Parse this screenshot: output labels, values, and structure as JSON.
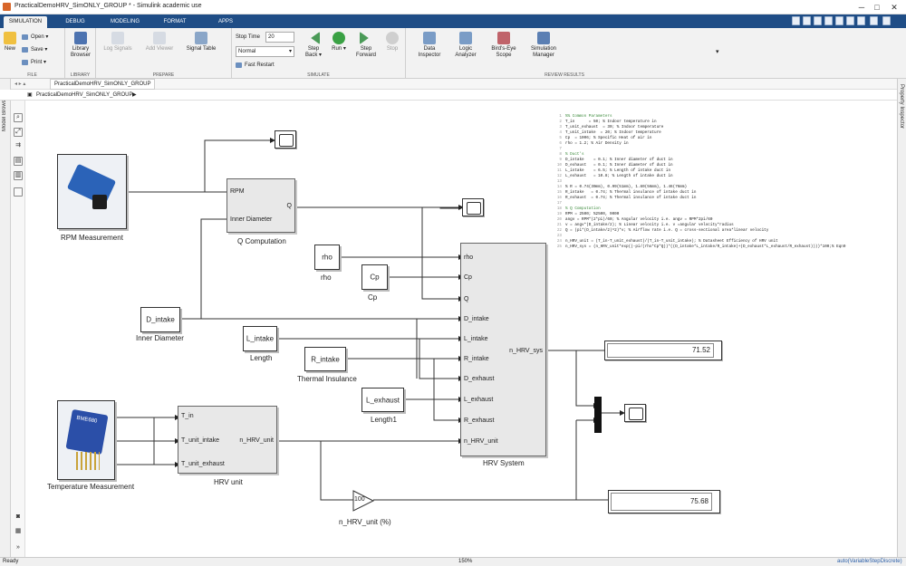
{
  "window": {
    "title": "PracticalDemoHRV_SimONLY_GROUP * - Simulink academic use"
  },
  "tabs": [
    "SIMULATION",
    "DEBUG",
    "MODELING",
    "FORMAT",
    "APPS"
  ],
  "ribbon": {
    "file": {
      "open": "Open",
      "save": "Save",
      "print": "Print",
      "new": "New",
      "label": "FILE"
    },
    "library": {
      "browser": "Library Browser",
      "label": "LIBRARY"
    },
    "prepare": {
      "log": "Log Signals",
      "add_viewer": "Add Viewer",
      "signal_table": "Signal Table",
      "label": "PREPARE"
    },
    "simulate": {
      "stop_time_label": "Stop Time",
      "stop_time_value": "20",
      "mode": "Normal",
      "fast_restart": "Fast Restart",
      "step_back": "Step Back",
      "run": "Run",
      "step_forward": "Step Forward",
      "stop": "Stop",
      "label": "SIMULATE"
    },
    "review": {
      "data_inspector": "Data Inspector",
      "logic_analyzer": "Logic Analyzer",
      "birds_eye": "Bird's-Eye Scope",
      "sim_manager": "Simulation Manager",
      "label": "REVIEW RESULTS"
    }
  },
  "address": {
    "model": "PracticalDemoHRV_SimONLY_GROUP"
  },
  "breadcrumb": {
    "path": "PracticalDemoHRV_SimONLY_GROUP"
  },
  "side": {
    "model_browser": "Model Browser",
    "property_inspector": "Property Inspector"
  },
  "blocks": {
    "rpm": "RPM Measurement",
    "qcomp": "Q Computation",
    "qcomp_in1": "RPM",
    "qcomp_in2": "Inner Diameter",
    "qcomp_out": "Q",
    "rho_val": "rho",
    "rho_lbl": "rho",
    "cp_val": "Cp",
    "cp_lbl": "Cp",
    "d_val": "D_intake",
    "d_lbl": "Inner Diameter",
    "l_val": "L_intake",
    "l_lbl": "Length",
    "r_val": "R_intake",
    "r_lbl": "Thermal Insulance",
    "le_val": "L_exhaust",
    "le_lbl": "Length1",
    "hrv_sys": "HRV System",
    "hrv_ports": [
      "rho",
      "Cp",
      "Q",
      "D_intake",
      "L_intake",
      "R_intake",
      "D_exhaust",
      "L_exhaust",
      "R_exhaust",
      "n_HRV_unit"
    ],
    "hrv_sys_out": "n_HRV_sys",
    "temp": "Temperature Measurement",
    "hrv_unit": "HRV unit",
    "hrv_unit_ports": [
      "T_in",
      "T_unit_intake",
      "T_unit_exhaust"
    ],
    "hrv_unit_out": "n_HRV_unit",
    "gain_val": "100",
    "gain_lbl": "n_HRV_unit (%)",
    "display1": "71.52",
    "display2": "75.68",
    "sensor_chip": "BME680"
  },
  "code": [
    {
      "n": "1",
      "t": "%% Common Parameters",
      "cm": true
    },
    {
      "n": "2",
      "t": "T_in      = 50; % Indoor temperature in"
    },
    {
      "n": "3",
      "t": "T_unit_exhaust  = 30; % Indoor temperature"
    },
    {
      "n": "4",
      "t": "T_unit_intake  = 20; % Indoor temperature"
    },
    {
      "n": "5",
      "t": "Cp  = 1006; % Specific Heat of air in"
    },
    {
      "n": "6",
      "t": "rho = 1.2; % Air Density in"
    },
    {
      "n": "7",
      "t": ""
    },
    {
      "n": "8",
      "t": "% Duct's",
      "cm": true
    },
    {
      "n": "9",
      "t": "D_intake    = 0.1; % Inner diameter of duct in"
    },
    {
      "n": "10",
      "t": "D_exhaust   = 0.1; % Inner diameter of duct in"
    },
    {
      "n": "11",
      "t": "L_intake    = 6.5; % Length of intake duct in"
    },
    {
      "n": "12",
      "t": "L_exhaust   = 10.8; % Length of intake duct in"
    },
    {
      "n": "13",
      "t": ""
    },
    {
      "n": "14",
      "t": "% R = 0.74(30mm), 0.99(51mm), 1.80(56mm), 1.46(76mm)"
    },
    {
      "n": "15",
      "t": "R_intake   = 0.74; % Thermal insulance of intake duct in"
    },
    {
      "n": "16",
      "t": "R_exhaust  = 0.74; % Thermal insulance of intake duct in"
    },
    {
      "n": "17",
      "t": ""
    },
    {
      "n": "18",
      "t": "% Q Computation",
      "cm": true
    },
    {
      "n": "19",
      "t": "RPM = 2500; %2500, 9000"
    },
    {
      "n": "20",
      "t": "angv = RPM*(2*pi)/60; % Angular velocity i.e. angv = RPM*2pi/60"
    },
    {
      "n": "21",
      "t": "v = angv*(D_intake/2); % Linear velocity i.e. v =angular velocity*radius"
    },
    {
      "n": "22",
      "t": "Q = (pi*(D_intake/2)^2)*v; % Airflow rate i.e. Q = cross-sectional area*linear velocity"
    },
    {
      "n": "23",
      "t": ""
    },
    {
      "n": "24",
      "t": "n_HRV_unit = (T_in-T_unit_exhaust)/(T_in-T_unit_intake); % Datasheet Efficiency of HRV unit"
    },
    {
      "n": "25",
      "t": "n_HRV_sys = (n_HRV_unit*exp((-pi/(rho*Cp*Q))*((D_intake*L_intake/R_intake)+(D_exhaust*L_exhaust/R_exhaust))))*100;% Eqn9"
    }
  ],
  "status": {
    "left": "Ready",
    "zoom": "150%",
    "solver": "auto(VariableStepDiscrete)"
  },
  "colors": {
    "tabbar": "#1f4d86",
    "run": "#3aa144",
    "step": "#4a9a57"
  }
}
